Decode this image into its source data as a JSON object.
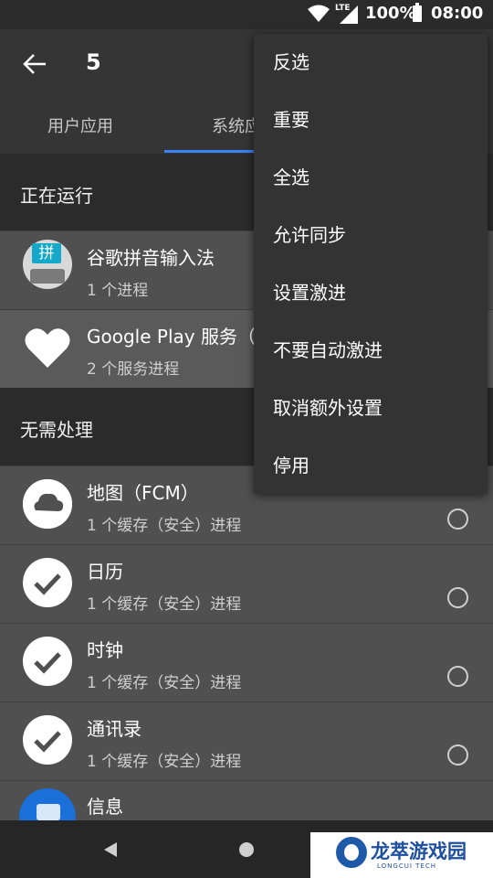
{
  "status_bar": {
    "network": "LTE",
    "battery": "100%",
    "time": "08:00"
  },
  "app_bar": {
    "title": "5",
    "tabs": [
      "用户应用",
      "系统应"
    ]
  },
  "sections": {
    "running": "正在运行",
    "no_action": "无需处理"
  },
  "running_apps": [
    {
      "name": "谷歌拼音输入法",
      "sub": "1 个进程",
      "icon_char": "拼"
    },
    {
      "name": "Google Play 服务（(",
      "sub": "2 个服务进程"
    }
  ],
  "idle_apps": [
    {
      "name": "地图（FCM）",
      "sub": "1 个缓存（安全）进程"
    },
    {
      "name": "日历",
      "sub": "1 个缓存（安全）进程"
    },
    {
      "name": "时钟",
      "sub": "1 个缓存（安全）进程"
    },
    {
      "name": "通讯录",
      "sub": "1 个缓存（安全）进程"
    },
    {
      "name": "信息"
    }
  ],
  "menu": {
    "items": [
      "反选",
      "重要",
      "全选",
      "允许同步",
      "设置激进",
      "不要自动激进",
      "取消额外设置",
      "停用"
    ]
  },
  "watermark": {
    "name": "龙萃游戏园",
    "sub": "LONGCUI TECH"
  }
}
